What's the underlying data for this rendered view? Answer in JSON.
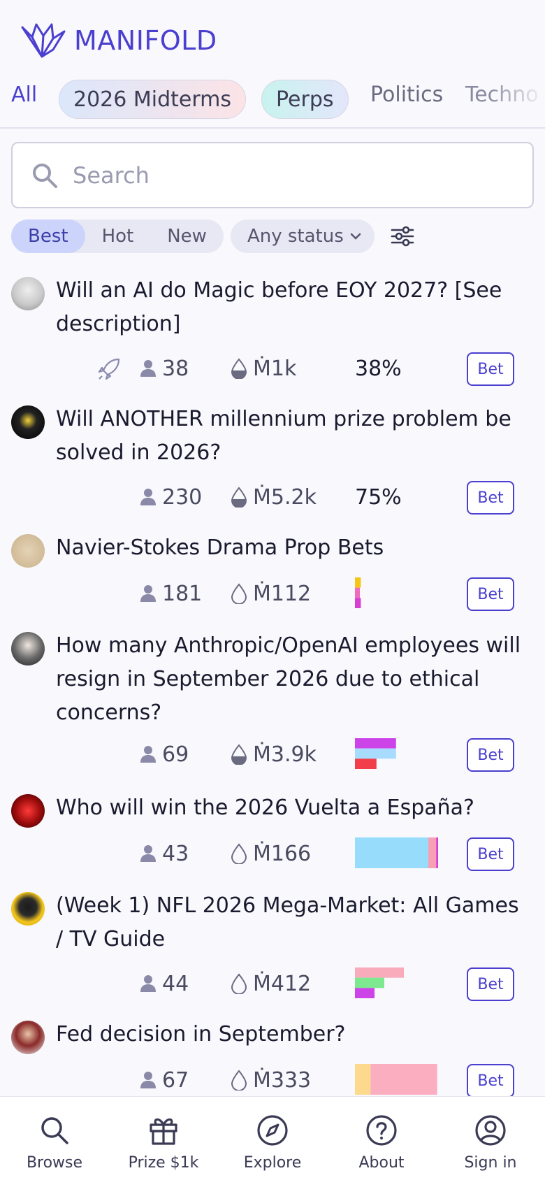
{
  "app": {
    "logo_text": "MANIFOLD"
  },
  "topics": [
    {
      "label": "All"
    },
    {
      "label": "2026 Midterms"
    },
    {
      "label": "Perps"
    },
    {
      "label": "Politics"
    },
    {
      "label": "Techno"
    }
  ],
  "search": {
    "placeholder": "Search"
  },
  "sort": {
    "options": [
      "Best",
      "Hot",
      "New"
    ],
    "selected": "Best"
  },
  "status_filter": {
    "label": "Any status"
  },
  "markets": [
    {
      "title": "Will an AI do Magic before EOY 2027? [See description]",
      "traders": "38",
      "volume": "Ṁ1k",
      "probability": "38%",
      "bet_label": "Bet",
      "boosted": true
    },
    {
      "title": "Will ANOTHER millennium prize problem be solved in 2026?",
      "traders": "230",
      "volume": "Ṁ5.2k",
      "probability": "75%",
      "bet_label": "Bet"
    },
    {
      "title": "Navier-Stokes Drama Prop Bets",
      "traders": "181",
      "volume": "Ṁ112",
      "bet_label": "Bet",
      "answers": [
        {
          "color": "#f5c518",
          "value": 0.06
        },
        {
          "color": "#f06bbd",
          "value": 0.05
        },
        {
          "color": "#d63fd1",
          "value": 0.06
        }
      ]
    },
    {
      "title": "How many Anthropic/OpenAI employees will resign in September 2026 due to ethical concerns?",
      "traders": "69",
      "volume": "Ṁ3.9k",
      "bet_label": "Bet",
      "answers": [
        {
          "color": "#cc44e8",
          "value": 0.42
        },
        {
          "color": "#a8dcff",
          "value": 0.42
        },
        {
          "color": "#f23d4b",
          "value": 0.22
        }
      ]
    },
    {
      "title": "Who will win the 2026 Vuelta a España?",
      "traders": "43",
      "volume": "Ṁ166",
      "bet_label": "Bet",
      "answers": [
        {
          "color": "#98dcfb",
          "value": 0.75,
          "stacked": true
        },
        {
          "color": "#f7a0b5",
          "value": 0.08,
          "stacked": true
        },
        {
          "color": "#d63fd1",
          "value": 0.02,
          "stacked": true
        }
      ]
    },
    {
      "title": "(Week 1) NFL 2026 Mega-Market: All Games / TV Guide",
      "traders": "44",
      "volume": "Ṁ412",
      "bet_label": "Bet",
      "answers": [
        {
          "color": "#f9aabb",
          "value": 0.5
        },
        {
          "color": "#7de88f",
          "value": 0.3
        },
        {
          "color": "#cc44e8",
          "value": 0.2
        }
      ]
    },
    {
      "title": "Fed decision in September?",
      "traders": "67",
      "volume": "Ṁ333",
      "bet_label": "Bet",
      "answers": [
        {
          "color": "#fcd98c",
          "value": 0.16,
          "stacked": true
        },
        {
          "color": "#fbaec0",
          "value": 0.68,
          "stacked": true
        }
      ]
    }
  ],
  "bottom_nav": [
    {
      "label": "Browse",
      "icon": "search-icon"
    },
    {
      "label": "Prize $1k",
      "icon": "gift-icon"
    },
    {
      "label": "Explore",
      "icon": "compass-icon"
    },
    {
      "label": "About",
      "icon": "question-icon"
    },
    {
      "label": "Sign in",
      "icon": "user-circle-icon"
    }
  ],
  "colors": {
    "brand": "#4a3fcf",
    "sort_active_bg": "#cdd4fb"
  }
}
